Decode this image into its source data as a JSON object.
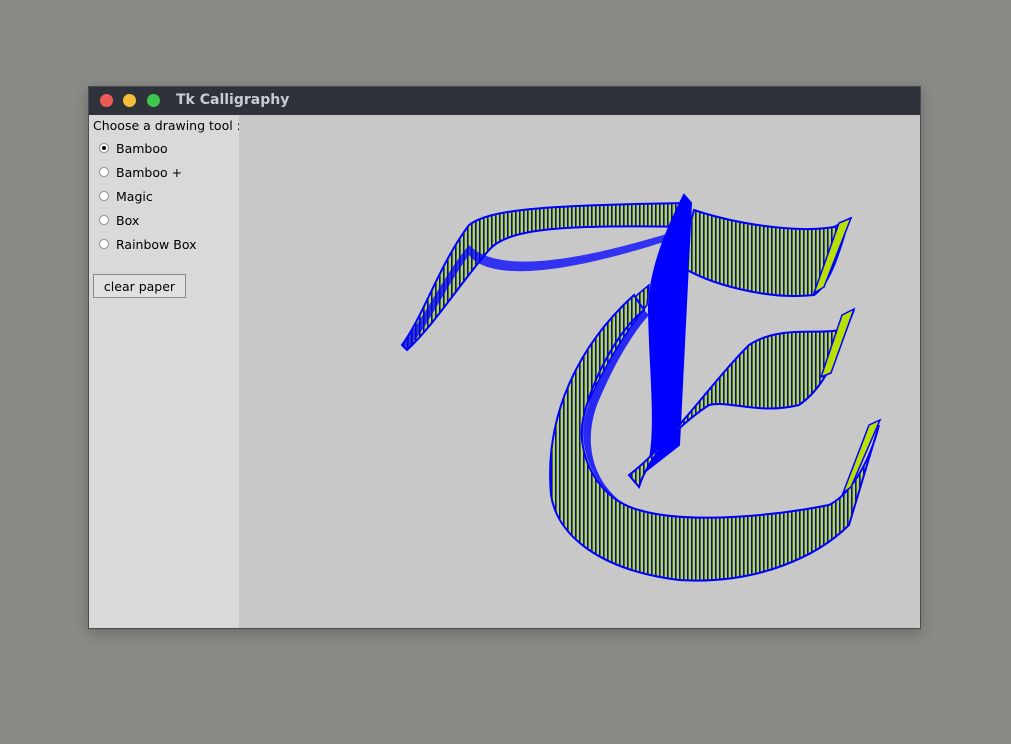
{
  "window": {
    "title": "Tk Calligraphy"
  },
  "sidebar": {
    "prompt": "Choose a drawing tool :",
    "tools": [
      {
        "label": "Bamboo",
        "selected": true
      },
      {
        "label": "Bamboo +",
        "selected": false
      },
      {
        "label": "Magic",
        "selected": false
      },
      {
        "label": "Box",
        "selected": false
      },
      {
        "label": "Rainbow Box",
        "selected": false
      }
    ],
    "clear_label": "clear paper"
  },
  "canvas": {
    "stroke_color": "#0000ff",
    "highlight_color": "#b8e000",
    "background": "#c8c8c8"
  }
}
